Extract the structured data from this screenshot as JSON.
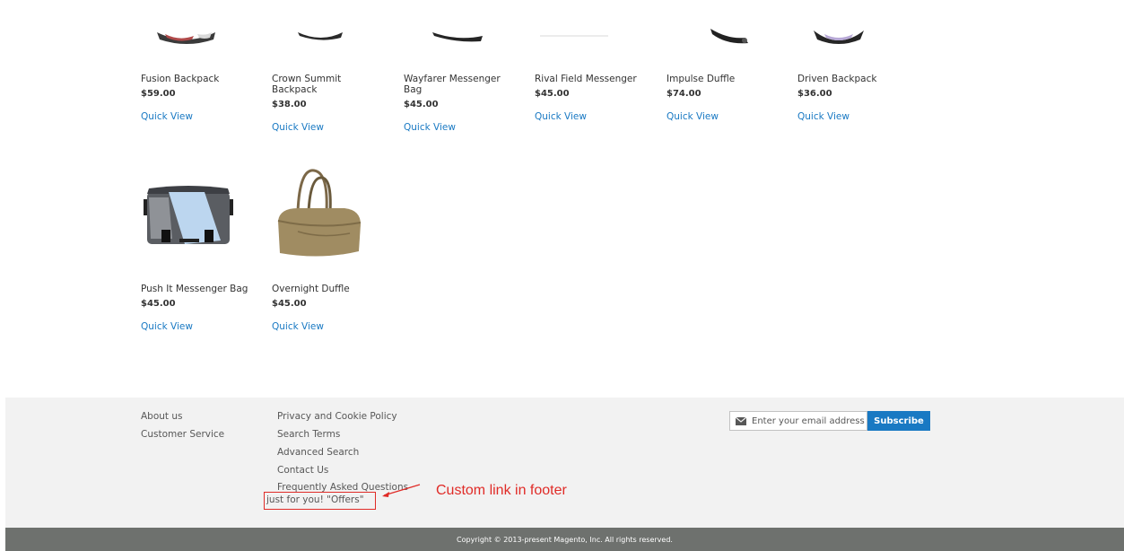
{
  "products": [
    {
      "name": "Fusion Backpack",
      "price": "$59.00",
      "quick_view": "Quick View"
    },
    {
      "name": "Crown Summit Backpack",
      "price": "$38.00",
      "quick_view": "Quick View"
    },
    {
      "name": "Wayfarer Messenger Bag",
      "price": "$45.00",
      "quick_view": "Quick View"
    },
    {
      "name": "Rival Field Messenger",
      "price": "$45.00",
      "quick_view": "Quick View"
    },
    {
      "name": "Impulse Duffle",
      "price": "$74.00",
      "quick_view": "Quick View"
    },
    {
      "name": "Driven Backpack",
      "price": "$36.00",
      "quick_view": "Quick View"
    },
    {
      "name": "Push It Messenger Bag",
      "price": "$45.00",
      "quick_view": "Quick View"
    },
    {
      "name": "Overnight Duffle",
      "price": "$45.00",
      "quick_view": "Quick View"
    }
  ],
  "footer": {
    "col1": [
      "About us",
      "Customer Service"
    ],
    "col2": [
      "Privacy and Cookie Policy",
      "Search Terms",
      "Advanced Search",
      "Contact Us",
      "Frequently Asked Questions",
      "just for you! \"Offers\""
    ],
    "newsletter": {
      "placeholder": "Enter your email address",
      "button": "Subscribe"
    },
    "copyright": "Copyright © 2013-present Magento, Inc. All rights reserved."
  },
  "annotation": {
    "text": "Custom link in footer",
    "color": "#e02b27"
  },
  "colors": {
    "link": "#1979c3",
    "footer_bg": "#f2f2f2",
    "copyright_bg": "#6e716e",
    "accent": "#1979c3"
  }
}
